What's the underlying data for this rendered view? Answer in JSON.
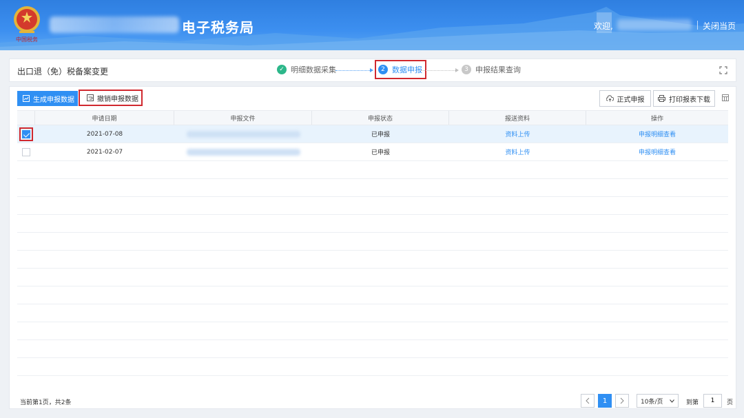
{
  "header": {
    "site_title": "电子税务局",
    "welcome": "欢迎,",
    "close_page": "关闭当页"
  },
  "steps": {
    "page_title": "出口退（免）税备案变更",
    "items": [
      {
        "num": "✓",
        "label": "明细数据采集",
        "state": "done"
      },
      {
        "num": "2",
        "label": "数据申报",
        "state": "current"
      },
      {
        "num": "3",
        "label": "申报结果查询",
        "state": "pending"
      }
    ]
  },
  "toolbar": {
    "generate": "生成申报数据",
    "revoke": "撤销申报数据",
    "formal": "正式申报",
    "print": "打印报表下载"
  },
  "table": {
    "columns": [
      "申请日期",
      "申报文件",
      "申报状态",
      "报送资料",
      "操作"
    ],
    "rows": [
      {
        "date": "2021-07-08",
        "status": "已申报",
        "upload": "资料上传",
        "action": "申报明细查看",
        "checked": true
      },
      {
        "date": "2021-02-07",
        "status": "已申报",
        "upload": "资料上传",
        "action": "申报明细查看",
        "checked": false
      }
    ]
  },
  "footer": {
    "info": "当前第1页，共2条",
    "current_page": "1",
    "page_size": "10条/页",
    "goto_label": "到第",
    "goto_value": "1",
    "goto_unit": "页"
  },
  "colors": {
    "primary": "#2f8ff3",
    "highlight_border": "#d0282e",
    "step_done": "#2db78a"
  }
}
